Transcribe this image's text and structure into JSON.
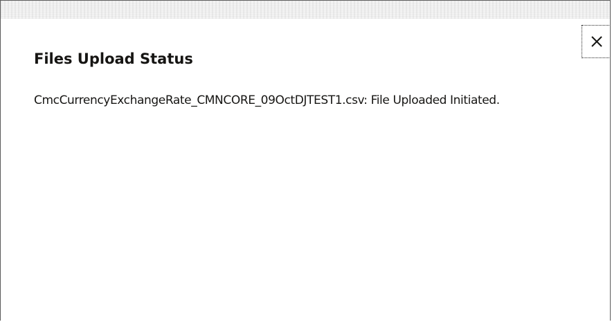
{
  "dialog": {
    "title": "Files Upload Status",
    "close_icon": "close-icon",
    "messages": [
      "CmcCurrencyExchangeRate_CMNCORE_09OctDJTEST1.csv: File Uploaded Initiated."
    ]
  }
}
